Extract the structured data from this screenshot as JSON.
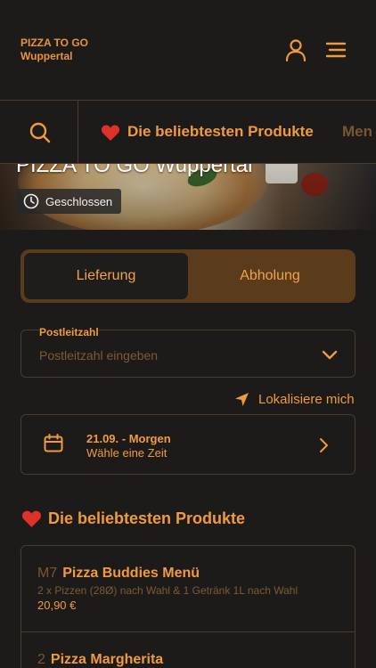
{
  "header": {
    "brand_line1": "PIZZA TO GO",
    "brand_line2": "Wuppertal",
    "icons": {
      "account": "user-icon",
      "menu": "hamburger-icon"
    }
  },
  "category_bar": {
    "search_icon": "search-icon",
    "items": [
      {
        "label": "Die beliebtesten Produkte",
        "icon": "heart-icon",
        "active": true
      },
      {
        "label": "Men",
        "active": false
      }
    ]
  },
  "hero": {
    "title": "PIZZA TO GO Wuppertal",
    "status": "Geschlossen",
    "status_icon": "clock-icon"
  },
  "order_type": {
    "options": [
      "Lieferung",
      "Abholung"
    ],
    "selected": "Lieferung"
  },
  "zip": {
    "label": "Postleitzahl",
    "placeholder": "Postleitzahl eingeben",
    "value": ""
  },
  "locate": {
    "label": "Lokalisiere mich",
    "icon": "location-arrow-icon"
  },
  "delivery_time": {
    "date": "21.09. - Morgen",
    "hint": "Wähle eine Zeit",
    "icon": "calendar-icon"
  },
  "popular": {
    "title": "Die beliebtesten Produkte",
    "icon": "heart-icon",
    "products": [
      {
        "code": "M7",
        "name": "Pizza Buddies Menü",
        "description": "2 x Pizzen (28Ø) nach Wahl & 1 Getränk 1L nach Wahl",
        "price": "20,90 €"
      },
      {
        "code": "2",
        "name": "Pizza Margherita"
      }
    ]
  },
  "colors": {
    "accent": "#f09a3e",
    "background": "#1c1b1a",
    "border": "#4a3b2a",
    "toggle_bg": "#5a3b1b",
    "heart": "#e0302a"
  }
}
